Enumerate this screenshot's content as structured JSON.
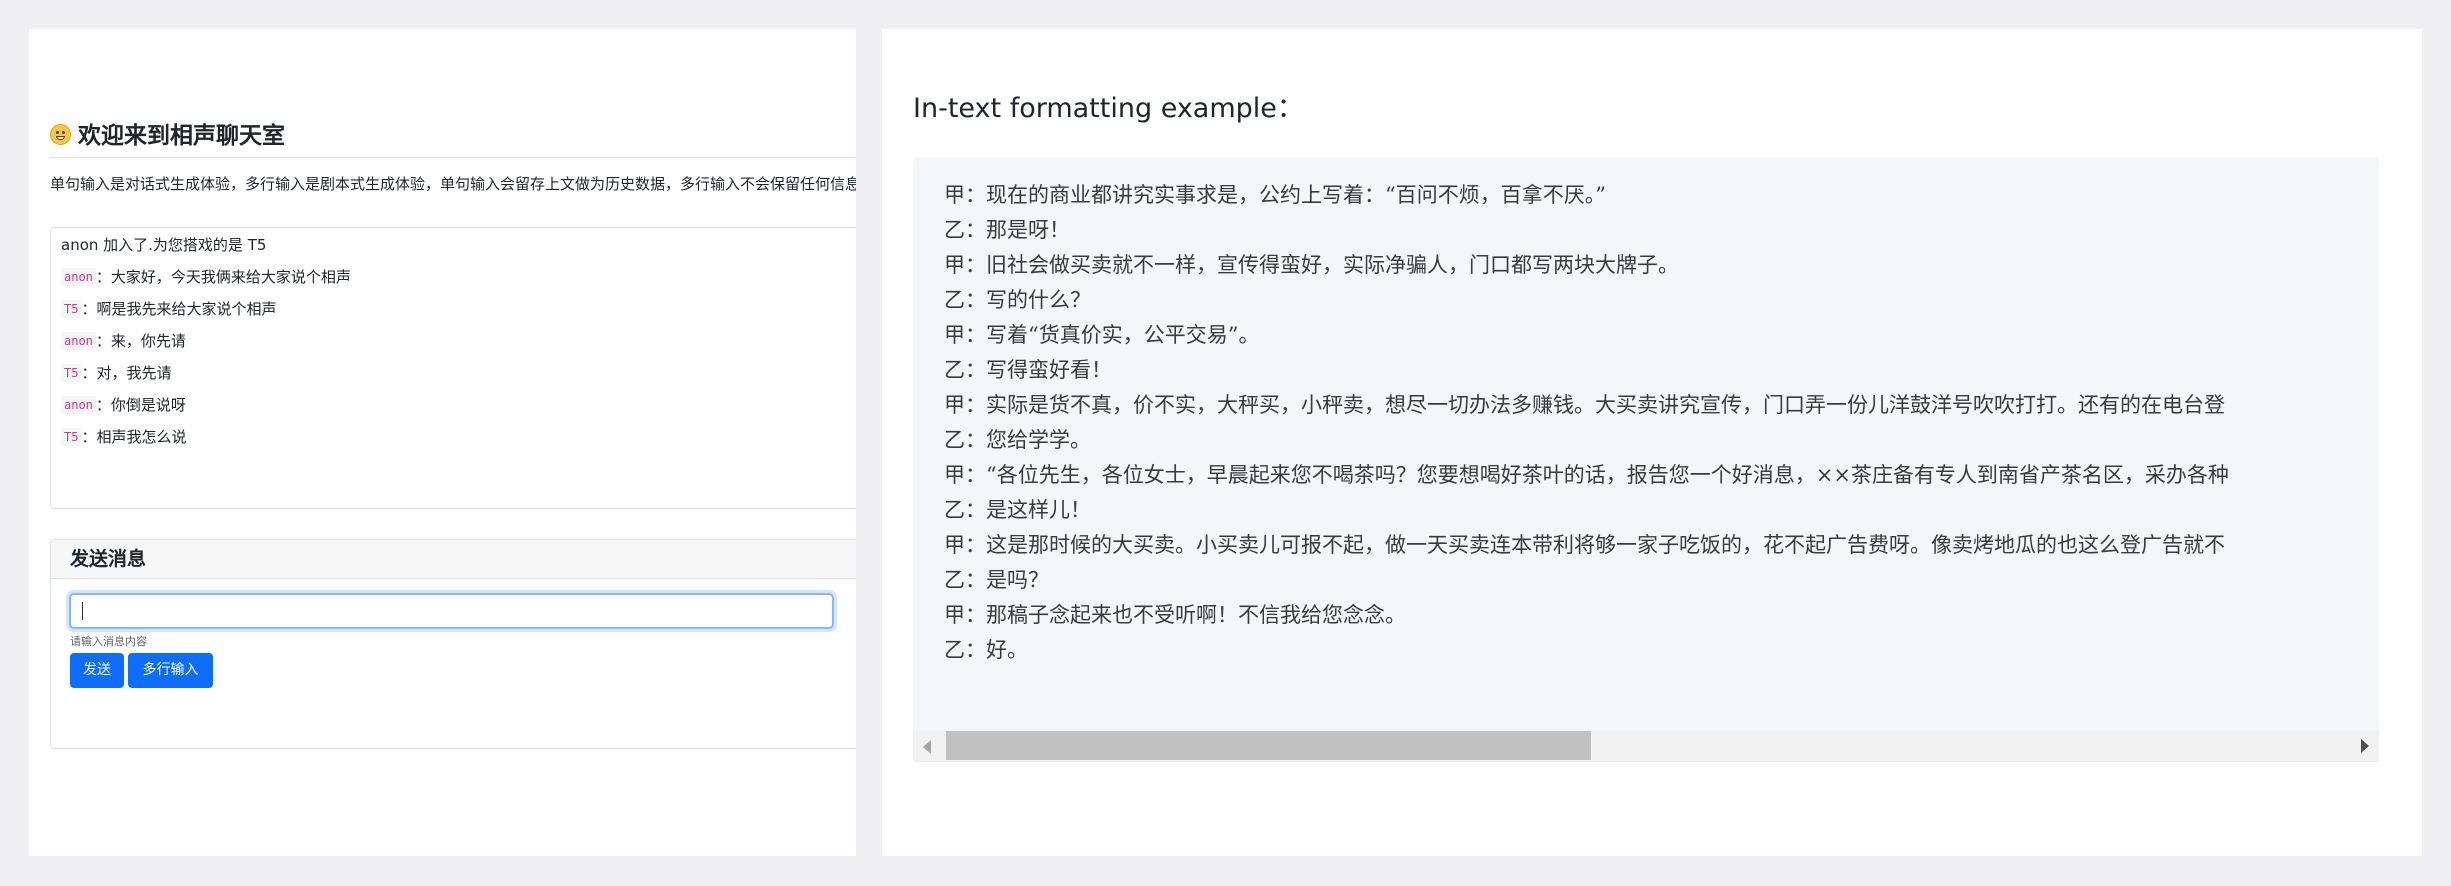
{
  "chat": {
    "title": "欢迎来到相声聊天室",
    "description": "单句输入是对话式生成体验，多行输入是剧本式生成体验，单句输入会留存上文做为历史数据，多行输入不会保留任何信息",
    "system_message": "anon 加入了.为您搭戏的是 T5",
    "messages": [
      {
        "sender": "anon",
        "text": "大家好，今天我俩来给大家说个相声"
      },
      {
        "sender": "T5",
        "text": "啊是我先来给大家说个相声"
      },
      {
        "sender": "anon",
        "text": "来，你先请"
      },
      {
        "sender": "T5",
        "text": "对，我先请"
      },
      {
        "sender": "anon",
        "text": "你倒是说呀"
      },
      {
        "sender": "T5",
        "text": "相声我怎么说"
      }
    ]
  },
  "send": {
    "header": "发送消息",
    "input_value": "",
    "hint": "请输入消息内容",
    "send_label": "发送",
    "multiline_label": "多行输入"
  },
  "example": {
    "heading": "In-text formatting example：",
    "lines": [
      "甲：现在的商业都讲究实事求是，公约上写着：“百问不烦，百拿不厌。”",
      "乙：那是呀！",
      "甲：旧社会做买卖就不一样，宣传得蛮好，实际净骗人，门口都写两块大牌子。",
      "乙：写的什么？",
      "甲：写着“货真价实，公平交易”。",
      "乙：写得蛮好看！",
      "甲：实际是货不真，价不实，大秤买，小秤卖，想尽一切办法多赚钱。大买卖讲究宣传，门口弄一份儿洋鼓洋号吹吹打打。还有的在电台登",
      "乙：您给学学。",
      "甲：“各位先生，各位女士，早晨起来您不喝茶吗？您要想喝好茶叶的话，报告您一个好消息，××茶庄备有专人到南省产茶名区，采办各种",
      "乙：是这样儿！",
      "甲：这是那时候的大买卖。小买卖儿可报不起，做一天买卖连本带利将够一家子吃饭的，花不起广告费呀。像卖烤地瓜的也这么登广告就不",
      "乙：是吗？",
      "甲：那稿子念起来也不受听啊！不信我给您念念。",
      "乙：好。"
    ]
  },
  "colors": {
    "primary_button": "#0d6efd",
    "sender_tag_text": "#d63384",
    "focus_border": "#86b7fe"
  }
}
